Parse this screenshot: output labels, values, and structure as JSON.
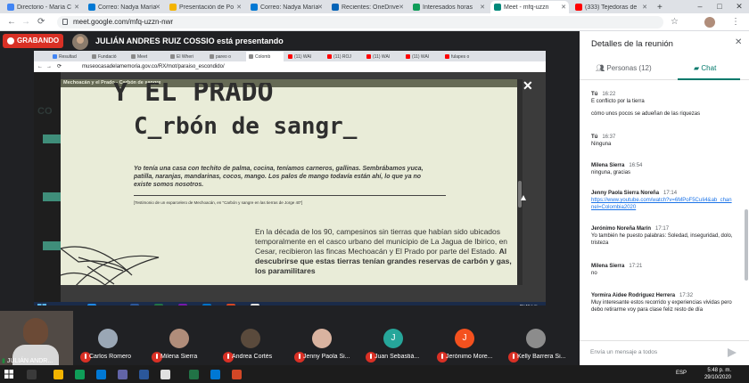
{
  "browser": {
    "tabs": [
      {
        "label": "Directorio - María C",
        "color": "#4285f4"
      },
      {
        "label": "Correo: Nadya María",
        "color": "#0078d4"
      },
      {
        "label": "Presentación de Po",
        "color": "#f4b400"
      },
      {
        "label": "Correo: Nadya María",
        "color": "#0078d4"
      },
      {
        "label": "Recientes: OneDrive",
        "color": "#0364b8"
      },
      {
        "label": "Interesados horas",
        "color": "#0f9d58"
      },
      {
        "label": "Meet - mfq-uzzn",
        "color": "#00897b"
      },
      {
        "label": "(333) Tejedoras de",
        "color": "#ff0000"
      }
    ],
    "new_tab": "+",
    "url": "meet.google.com/mfq-uzzn-nwr",
    "win_minimize": "–",
    "win_maximize": "□",
    "win_close": "✕"
  },
  "meet": {
    "recording_label": "GRABANDO",
    "presenter_text": "JULIÁN ANDRES RUIZ COSSIO está presentando"
  },
  "shared": {
    "tabs": [
      "Resultad",
      "Fundació",
      "Meet",
      "El Wheri",
      "pareo o",
      "Colomb",
      "(11) WAI",
      "(11) ROJ",
      "(11) WAI",
      "(11) WAI",
      "fulapes o"
    ],
    "url": "museocasadelamemoria.gov.co/RX/mot/paraiso_escondido/",
    "left_text": "CO",
    "doc_header": "Mechoacán y el Prado - Carbón de sangre",
    "big_title": "Y EL PRADO",
    "subtitle": "C_rbón de sangr_",
    "quote": "Yo tenía una casa con techito de palma, cocina, teníamos carneros, gallinas. Sembrábamos yuca, patilla, naranjas, mandarinas, cocos, mango. Los palos de mango todavía están ahí, lo que ya no existe somos nosotros.",
    "testimony": "[Testimonio de un exparcelero de Mechoacán, en \"Carbón y sangre en las tierras de Jorge 40\"]",
    "body_plain": "En la década de los 90, campesinos sin tierras que habían sido ubicados temporalmente en el casco urbano del municipio de La Jagua de Ibirico, en Cesar, recibieron las fincas Mechoacán y El Prado por parte del Estado. ",
    "body_bold": "Al descubrirse que estas tierras tenían grandes reservas de carbón y gas, los paramilitares",
    "close": "✕",
    "clock_time": "05:48 p.m.",
    "clock_date": "29/10/2020",
    "lang": "ES"
  },
  "participants": {
    "self_name": "JULIÁN ANDR...",
    "list": [
      {
        "name": "Carlos Romero",
        "avatar_color": "#9aa7b5",
        "initial": ""
      },
      {
        "name": "Milena Sierra",
        "avatar_color": "#b08d7a",
        "initial": ""
      },
      {
        "name": "Andrea Cortés",
        "avatar_color": "#5a4a3c",
        "initial": ""
      },
      {
        "name": "Jenny Paola Si...",
        "avatar_color": "#d9b3a0",
        "initial": ""
      },
      {
        "name": "Juan Sebastiá...",
        "avatar_color": "#26a69a",
        "initial": "J"
      },
      {
        "name": "Jerónimo More...",
        "avatar_color": "#f4511e",
        "initial": "J"
      },
      {
        "name": "Kelly Barrera Si...",
        "avatar_color": "#8c8c8c",
        "initial": ""
      }
    ]
  },
  "panel": {
    "title": "Detalles de la reunión",
    "close": "✕",
    "tab_people": "Personas (12)",
    "tab_chat": "Chat",
    "messages": [
      {
        "who": "Tú",
        "time": "16:22",
        "text": "E conflicto por la tierra",
        "link": ""
      },
      {
        "who": "",
        "time": "",
        "text": "cómo unos pocos se adueñan de las riquezas",
        "link": ""
      },
      {
        "who": "Tú",
        "time": "16:37",
        "text": "Ninguna",
        "link": ""
      },
      {
        "who": "Milena Sierra",
        "time": "16:54",
        "text": "ninguna, gracias",
        "link": ""
      },
      {
        "who": "Jenny Paola Sierra Noreña",
        "time": "17:14",
        "text": "",
        "link": "https://www.youtube.com/watch?v=6MPoF5CuIi4&ab_channel=Colombia2020"
      },
      {
        "who": "Jerónimo Noreña Marín",
        "time": "17:17",
        "text": "Yo también he puesto palabras: Soledad, inseguridad, dolo, tristeza",
        "link": ""
      },
      {
        "who": "Milena Sierra",
        "time": "17:21",
        "text": "no",
        "link": ""
      },
      {
        "who": "Yormira Aidee Rodriguez Herrera",
        "time": "17:32",
        "text": "Muy interesante estos recorrido y experiencias vividas pero debo retirarme voy para clase feliz resto de día",
        "link": ""
      }
    ],
    "input_placeholder": "Envía un mensaje a todos"
  },
  "taskbar": {
    "lang": "ESP",
    "time": "5:48 p. m.",
    "date": "29/10/2020"
  },
  "colors": {
    "meet_bg": "#202124",
    "record_red": "#d93025",
    "chat_teal": "#00796b",
    "doc_bg": "#e9ecd8",
    "link_blue": "#1a73e8"
  }
}
